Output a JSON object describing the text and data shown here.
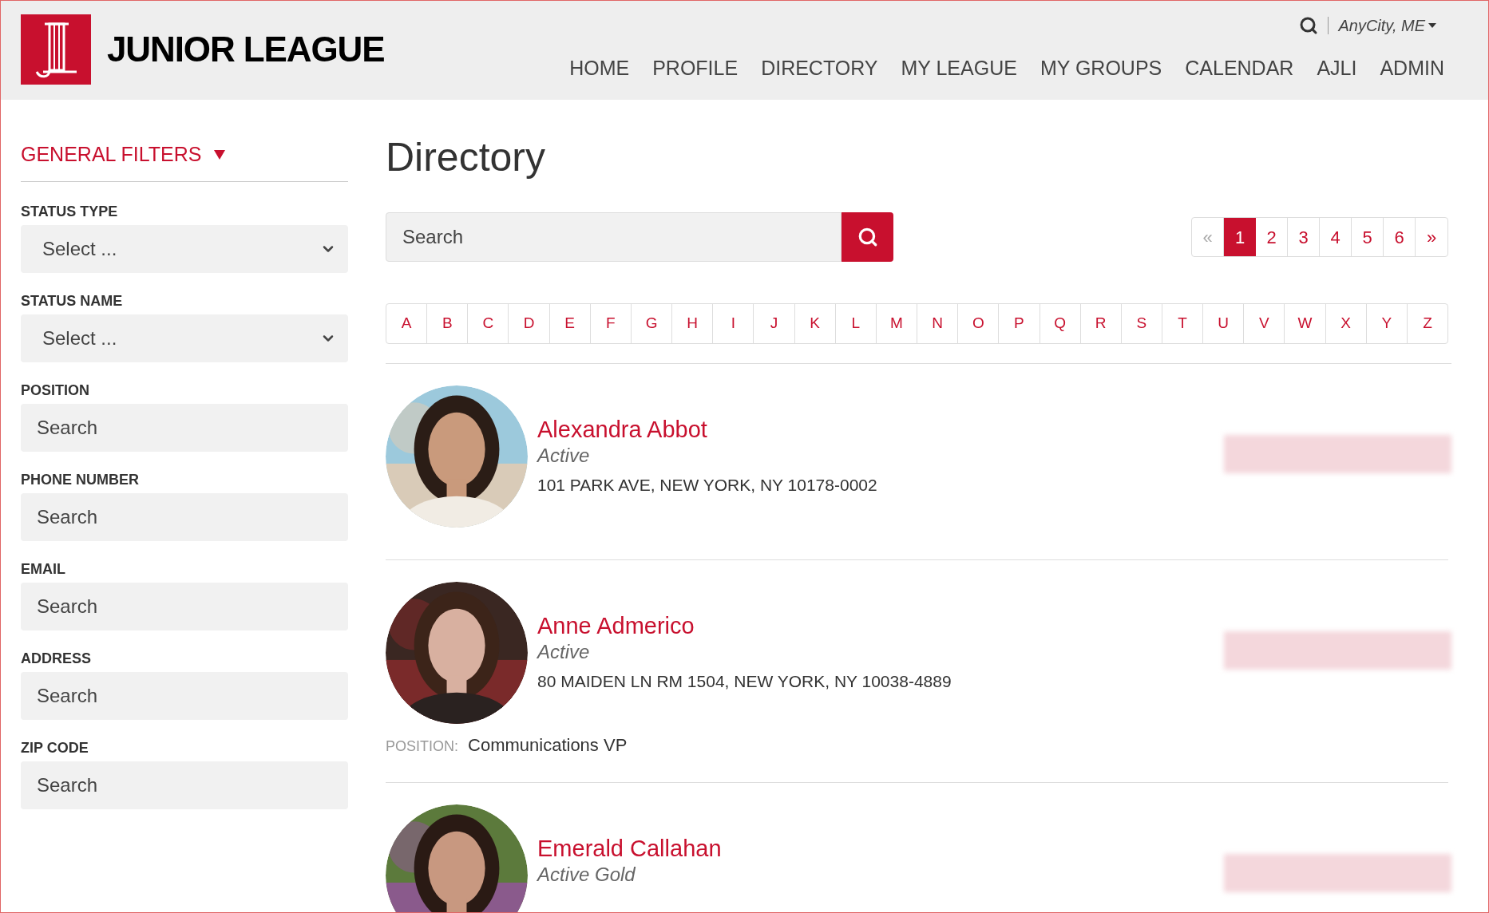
{
  "header": {
    "logo_text": "JUNIOR LEAGUE",
    "location": "AnyCity, ME",
    "nav": [
      {
        "label": "HOME",
        "selected": false
      },
      {
        "label": "PROFILE",
        "selected": false
      },
      {
        "label": "DIRECTORY",
        "selected": false
      },
      {
        "label": "MY LEAGUE",
        "selected": false
      },
      {
        "label": "MY GROUPS",
        "selected": false
      },
      {
        "label": "CALENDAR",
        "selected": false
      },
      {
        "label": "AJLI",
        "selected": false
      },
      {
        "label": "ADMIN",
        "selected": false
      }
    ]
  },
  "sidebar": {
    "title": "GENERAL FILTERS",
    "expanded": true,
    "filters": [
      {
        "label": "STATUS TYPE",
        "kind": "select",
        "value": "Select ..."
      },
      {
        "label": "STATUS NAME",
        "kind": "select",
        "value": "Select ..."
      },
      {
        "label": "POSITION",
        "kind": "text",
        "placeholder": "Search"
      },
      {
        "label": "PHONE NUMBER",
        "kind": "text",
        "placeholder": "Search"
      },
      {
        "label": "EMAIL",
        "kind": "text",
        "placeholder": "Search"
      },
      {
        "label": "ADDRESS",
        "kind": "text",
        "placeholder": "Search"
      },
      {
        "label": "ZIP CODE",
        "kind": "text",
        "placeholder": "Search"
      }
    ]
  },
  "main": {
    "title": "Directory",
    "search": {
      "placeholder": "Search"
    },
    "pagination": {
      "prev": "«",
      "next": "»",
      "pages": [
        {
          "label": "1",
          "selected": true
        },
        {
          "label": "2",
          "selected": false
        },
        {
          "label": "3",
          "selected": false
        },
        {
          "label": "4",
          "selected": false
        },
        {
          "label": "5",
          "selected": false
        },
        {
          "label": "6",
          "selected": false
        }
      ]
    },
    "letters": [
      "A",
      "B",
      "C",
      "D",
      "E",
      "F",
      "G",
      "H",
      "I",
      "J",
      "K",
      "L",
      "M",
      "N",
      "O",
      "P",
      "Q",
      "R",
      "S",
      "T",
      "U",
      "V",
      "W",
      "X",
      "Y",
      "Z"
    ],
    "members": [
      {
        "name": "Alexandra Abbot",
        "status": "Active",
        "address": "101 PARK AVE, NEW YORK, NY 10178-0002"
      },
      {
        "name": "Anne Admerico",
        "status": "Active",
        "address": "80 MAIDEN LN RM 1504, NEW YORK, NY 10038-4889",
        "position_label": "POSITION:",
        "position": "Communications VP"
      },
      {
        "name": "Emerald Callahan",
        "status": "Active Gold"
      }
    ]
  }
}
